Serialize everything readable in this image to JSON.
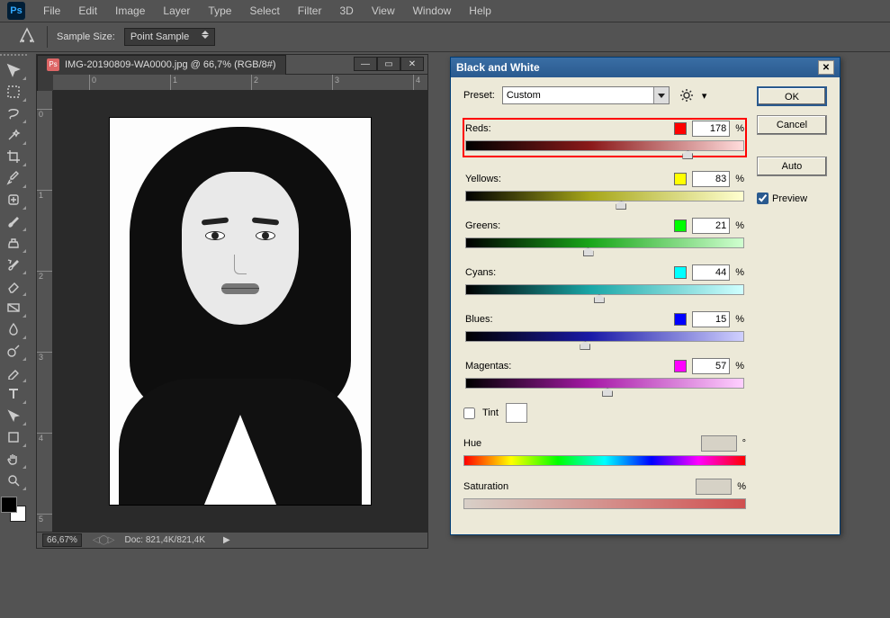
{
  "menubar": [
    "File",
    "Edit",
    "Image",
    "Layer",
    "Type",
    "Select",
    "Filter",
    "3D",
    "View",
    "Window",
    "Help"
  ],
  "options": {
    "sample_size_label": "Sample Size:",
    "sample_size_value": "Point Sample"
  },
  "toolbox": [
    "move-tool",
    "rect-marquee-tool",
    "lasso-tool",
    "magic-wand-tool",
    "crop-tool",
    "eyedropper-tool",
    "spot-healing-tool",
    "brush-tool",
    "clone-stamp-tool",
    "history-brush-tool",
    "eraser-tool",
    "gradient-tool",
    "blur-tool",
    "dodge-tool",
    "pen-tool",
    "type-tool",
    "path-selection-tool",
    "shape-tool",
    "hand-tool",
    "zoom-tool"
  ],
  "document": {
    "tab_title": "IMG-20190809-WA0000.jpg @ 66,7% (RGB/8#)",
    "zoom": "66,67%",
    "doc_status": "Doc: 821,4K/821,4K",
    "ruler_top": [
      "0",
      "1",
      "2",
      "3",
      "4"
    ],
    "ruler_left": [
      "0",
      "1",
      "2",
      "3",
      "4",
      "5"
    ]
  },
  "dialog": {
    "title": "Black and White",
    "preset_label": "Preset:",
    "preset_value": "Custom",
    "buttons": {
      "ok": "OK",
      "cancel": "Cancel",
      "auto": "Auto"
    },
    "preview_label": "Preview",
    "preview_checked": true,
    "sliders": [
      {
        "label": "Reds:",
        "color": "#ff0000",
        "value": "178",
        "pos": 80,
        "grad": "grad-reds",
        "hl": true,
        "name": "reds"
      },
      {
        "label": "Yellows:",
        "color": "#ffff00",
        "value": "83",
        "pos": 56,
        "grad": "grad-yellows",
        "hl": false,
        "name": "yellows"
      },
      {
        "label": "Greens:",
        "color": "#00ff00",
        "value": "21",
        "pos": 44,
        "grad": "grad-greens",
        "hl": false,
        "name": "greens"
      },
      {
        "label": "Cyans:",
        "color": "#00ffff",
        "value": "44",
        "pos": 48,
        "grad": "grad-cyans",
        "hl": false,
        "name": "cyans"
      },
      {
        "label": "Blues:",
        "color": "#0000ff",
        "value": "15",
        "pos": 43,
        "grad": "grad-blues",
        "hl": false,
        "name": "blues"
      },
      {
        "label": "Magentas:",
        "color": "#ff00ff",
        "value": "57",
        "pos": 51,
        "grad": "grad-magentas",
        "hl": false,
        "name": "magentas"
      }
    ],
    "tint_label": "Tint",
    "tint_checked": false,
    "hue_label": "Hue",
    "hue_unit": "°",
    "sat_label": "Saturation",
    "sat_unit": "%"
  }
}
